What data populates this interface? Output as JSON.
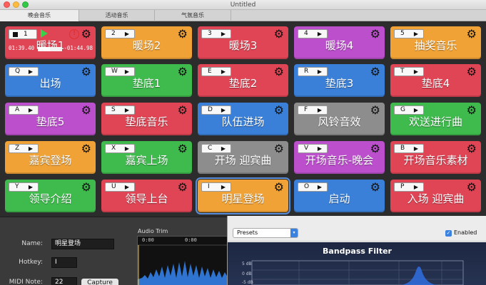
{
  "window": {
    "title": "Untitled"
  },
  "tabs": [
    {
      "label": "晚会音乐",
      "active": true
    },
    {
      "label": "活动音乐",
      "active": false
    },
    {
      "label": "气氛音乐",
      "active": false
    }
  ],
  "pads": [
    {
      "key": "1",
      "label": "暖场1",
      "color": "#e04555",
      "playing": true,
      "elapsed": "01:39.40",
      "remaining": "-01:44.98",
      "progress": 0.49
    },
    {
      "key": "2",
      "label": "暖场2",
      "color": "#f0a236"
    },
    {
      "key": "3",
      "label": "暖场3",
      "color": "#e04555"
    },
    {
      "key": "4",
      "label": "暖场4",
      "color": "#bb4fcc"
    },
    {
      "key": "5",
      "label": "抽奖音乐",
      "color": "#f0a236"
    },
    {
      "key": "Q",
      "label": "出场",
      "color": "#3a7fd8"
    },
    {
      "key": "W",
      "label": "垫底1",
      "color": "#3fba4d"
    },
    {
      "key": "E",
      "label": "垫底2",
      "color": "#e04555"
    },
    {
      "key": "R",
      "label": "垫底3",
      "color": "#3a7fd8"
    },
    {
      "key": "T",
      "label": "垫底4",
      "color": "#e04555"
    },
    {
      "key": "A",
      "label": "垫底5",
      "color": "#bb4fcc"
    },
    {
      "key": "S",
      "label": "垫底音乐",
      "color": "#e04555"
    },
    {
      "key": "D",
      "label": "队伍进场",
      "color": "#3a7fd8"
    },
    {
      "key": "F",
      "label": "风铃音效",
      "color": "#8d8d8d"
    },
    {
      "key": "G",
      "label": "欢送进行曲",
      "color": "#3fba4d"
    },
    {
      "key": "Z",
      "label": "嘉宾登场",
      "color": "#f0a236"
    },
    {
      "key": "X",
      "label": "嘉宾上场",
      "color": "#3fba4d"
    },
    {
      "key": "C",
      "label": "开场 迎宾曲",
      "color": "#8d8d8d"
    },
    {
      "key": "V",
      "label": "开场音乐-晚会",
      "color": "#bb4fcc"
    },
    {
      "key": "B",
      "label": "开场音乐素材",
      "color": "#e04555"
    },
    {
      "key": "Y",
      "label": "领导介绍",
      "color": "#3fba4d"
    },
    {
      "key": "U",
      "label": "领导上台",
      "color": "#e04555"
    },
    {
      "key": "I",
      "label": "明星登场",
      "color": "#f0a236",
      "selected": true
    },
    {
      "key": "O",
      "label": "启动",
      "color": "#3a7fd8"
    },
    {
      "key": "P",
      "label": "入场 迎宾曲",
      "color": "#e04555"
    }
  ],
  "details": {
    "name_label": "Name:",
    "name_value": "明星登场",
    "hotkey_label": "Hotkey:",
    "hotkey_value": "I",
    "midi_label": "MIDI Note:",
    "midi_value": "22",
    "capture_label": "Capture",
    "audio_trim_label": "Audio Trim",
    "trim_ticks": [
      "0:00",
      "0:00"
    ]
  },
  "audio_unit": {
    "presets_label": "Presets",
    "enabled_label": "Enabled",
    "enabled": true,
    "filter_title": "Bandpass Filter",
    "db_labels": [
      "5 dB",
      "0 dB",
      "-5 dB"
    ]
  }
}
